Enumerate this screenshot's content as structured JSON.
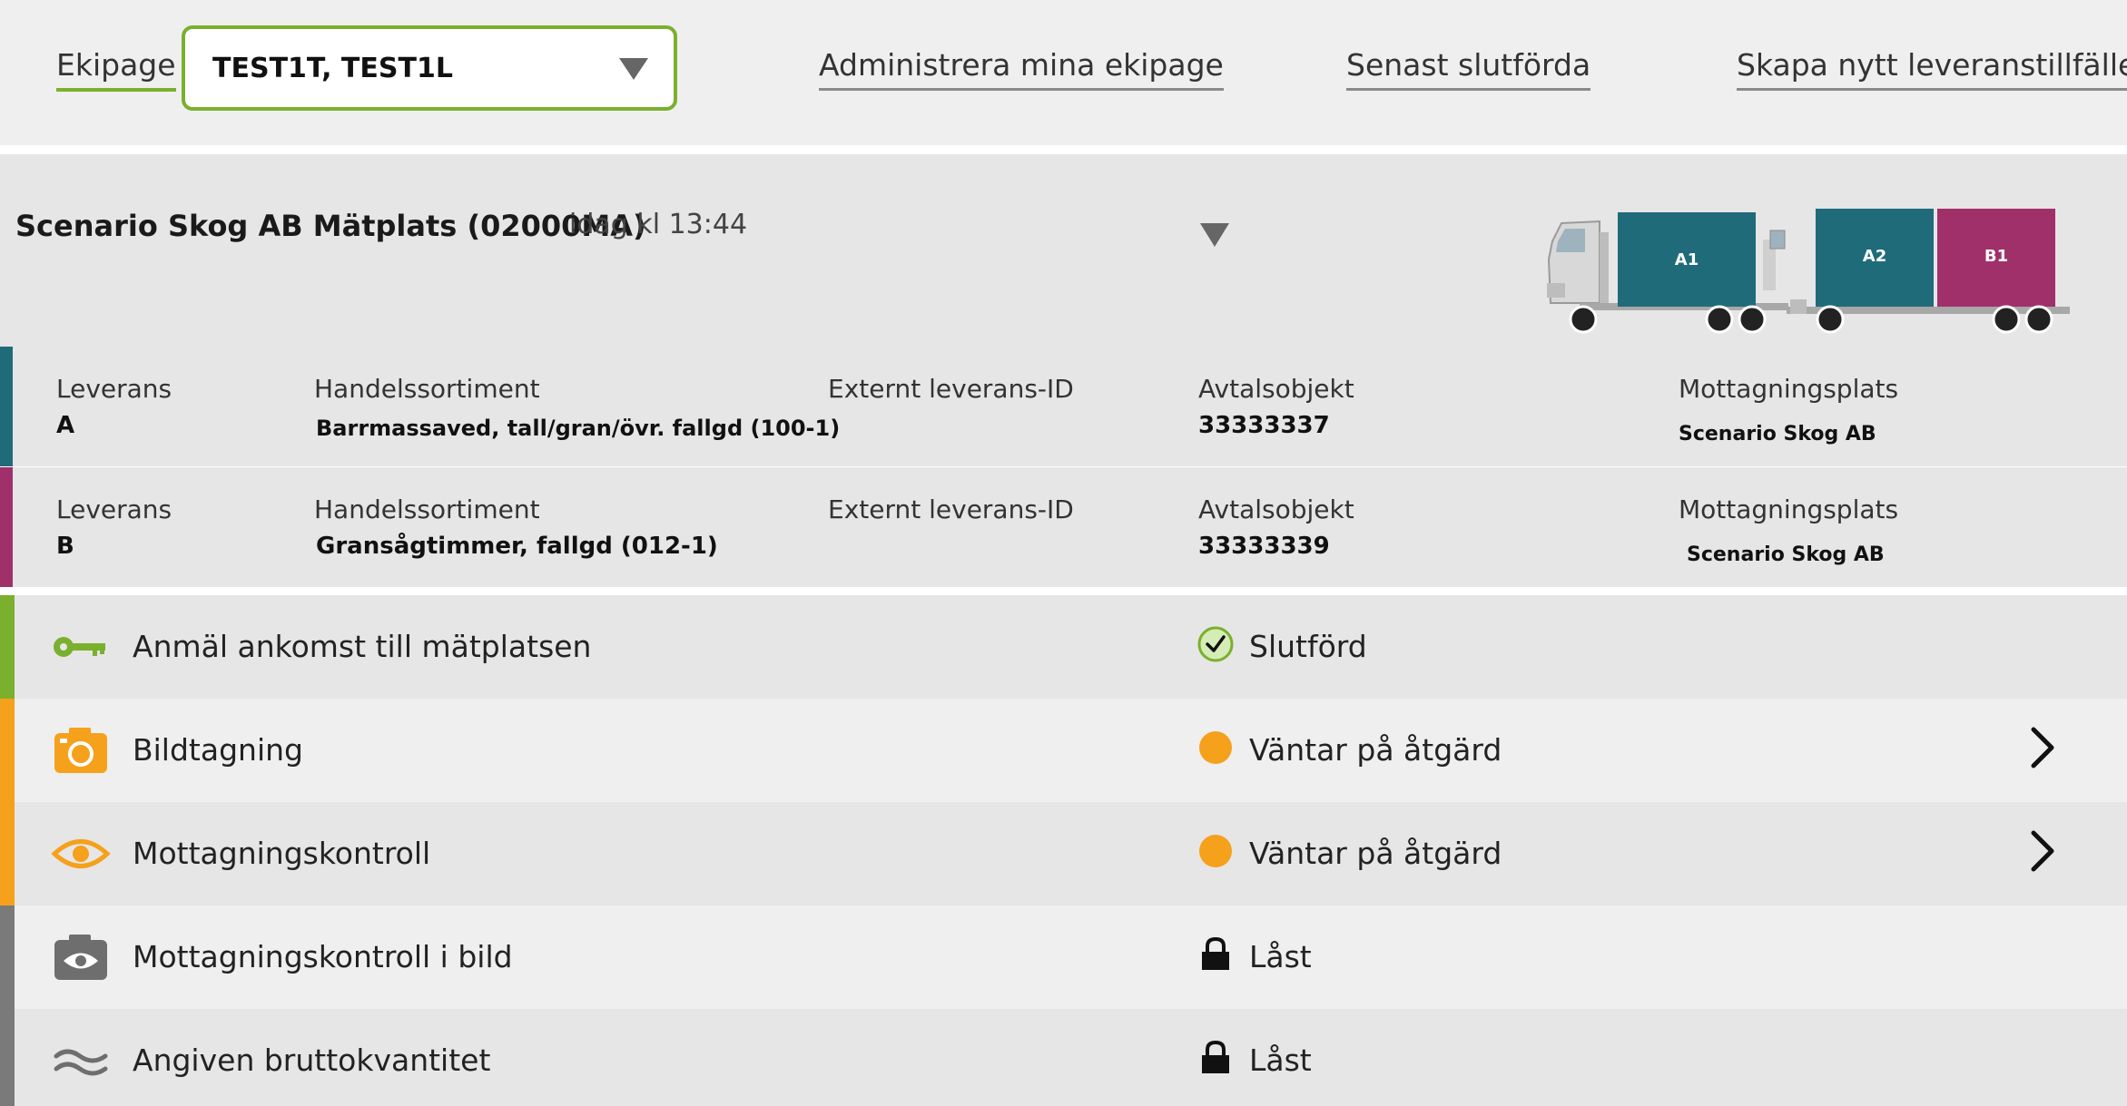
{
  "header": {
    "ekipage_label": "Ekipage",
    "ekipage_value": "TEST1T, TEST1L",
    "link_admin": "Administrera mina ekipage",
    "link_senast": "Senast slutförda",
    "link_skapa": "Skapa nytt leveranstillfälle"
  },
  "scenario": {
    "title": "Scenario Skog AB Mätplats (02000MA)",
    "time": "idag kl 13:44",
    "truck": {
      "containers": [
        {
          "label": "A1",
          "color": "#1f6b7a"
        },
        {
          "label": "A2",
          "color": "#1f6b7a"
        },
        {
          "label": "B1",
          "color": "#a0306a"
        }
      ]
    }
  },
  "labels": {
    "leverans": "Leverans",
    "handelssortiment": "Handelssortiment",
    "externt": "Externt leverans-ID",
    "avtalsobjekt": "Avtalsobjekt",
    "mottagningsplats": "Mottagningsplats"
  },
  "deliveries": [
    {
      "leverans": "A",
      "handelssortiment": "Barrmassaved, tall/gran/övr. fallgd (100-1)",
      "externt": "",
      "avtalsobjekt": "33333337",
      "mottagningsplats": "Scenario Skog AB",
      "color": "#1f6b7a"
    },
    {
      "leverans": "B",
      "handelssortiment": "Gransågtimmer, fallgd (012-1)",
      "externt": "",
      "avtalsobjekt": "33333339",
      "mottagningsplats": "Scenario Skog AB",
      "color": "#a0306a"
    }
  ],
  "steps": [
    {
      "label": "Anmäl ankomst till mätplatsen",
      "status": "Slutförd",
      "icon": "key-icon",
      "status_icon": "check-icon",
      "color": "#7ab02e"
    },
    {
      "label": "Bildtagning",
      "status": "Väntar på åtgärd",
      "icon": "camera-icon",
      "status_icon": "pending-dot-icon",
      "color": "#f5a11c"
    },
    {
      "label": "Mottagningskontroll",
      "status": "Väntar på åtgärd",
      "icon": "eye-icon",
      "status_icon": "pending-dot-icon",
      "color": "#f5a11c"
    },
    {
      "label": "Mottagningskontroll i bild",
      "status": "Låst",
      "icon": "camera-eye-icon",
      "status_icon": "lock-icon",
      "color": "#7a7a7a"
    },
    {
      "label": "Angiven bruttokvantitet",
      "status": "Låst",
      "icon": "approx-icon",
      "status_icon": "lock-icon",
      "color": "#7a7a7a"
    }
  ],
  "colors": {
    "accent_green": "#7ab02e",
    "pending_orange": "#f5a11c",
    "locked_gray": "#7a7a7a",
    "teal": "#1f6b7a",
    "magenta": "#a0306a"
  }
}
